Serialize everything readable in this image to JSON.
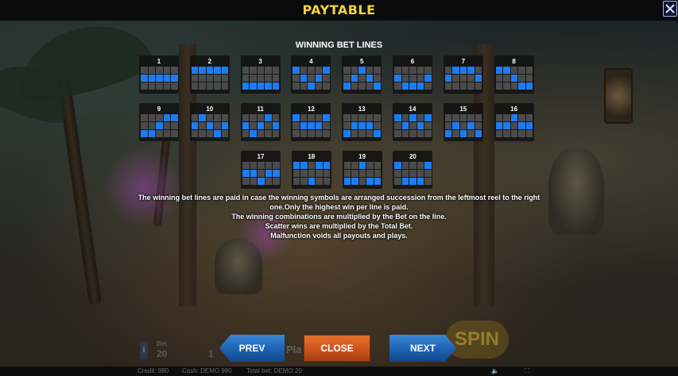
{
  "header": {
    "title": "PAYTABLE",
    "close_icon": "close-x-icon",
    "accent_color": "#f6d23a"
  },
  "section_title": "WINNING BET LINES",
  "colors": {
    "line_cell": "#1e7cf2",
    "empty_cell": "#4b4b4b",
    "card_bg": "#121212"
  },
  "bet_lines": [
    {
      "number": "1",
      "pattern": [
        1,
        1,
        1,
        1,
        1
      ]
    },
    {
      "number": "2",
      "pattern": [
        0,
        0,
        0,
        0,
        0
      ]
    },
    {
      "number": "3",
      "pattern": [
        2,
        2,
        2,
        2,
        2
      ]
    },
    {
      "number": "4",
      "pattern": [
        0,
        1,
        2,
        1,
        0
      ]
    },
    {
      "number": "5",
      "pattern": [
        2,
        1,
        0,
        1,
        2
      ]
    },
    {
      "number": "6",
      "pattern": [
        1,
        2,
        2,
        2,
        1
      ]
    },
    {
      "number": "7",
      "pattern": [
        1,
        0,
        0,
        0,
        1
      ]
    },
    {
      "number": "8",
      "pattern": [
        0,
        0,
        1,
        2,
        2
      ]
    },
    {
      "number": "9",
      "pattern": [
        2,
        2,
        1,
        0,
        0
      ]
    },
    {
      "number": "10",
      "pattern": [
        1,
        0,
        1,
        2,
        1
      ]
    },
    {
      "number": "11",
      "pattern": [
        1,
        2,
        1,
        0,
        1
      ]
    },
    {
      "number": "12",
      "pattern": [
        0,
        1,
        1,
        1,
        0
      ]
    },
    {
      "number": "13",
      "pattern": [
        2,
        1,
        1,
        1,
        2
      ]
    },
    {
      "number": "14",
      "pattern": [
        0,
        1,
        0,
        1,
        0
      ]
    },
    {
      "number": "15",
      "pattern": [
        2,
        1,
        2,
        1,
        2
      ]
    },
    {
      "number": "16",
      "pattern": [
        1,
        1,
        0,
        1,
        1
      ]
    },
    {
      "number": "17",
      "pattern": [
        1,
        1,
        2,
        1,
        1
      ]
    },
    {
      "number": "18",
      "pattern": [
        0,
        0,
        2,
        0,
        0
      ]
    },
    {
      "number": "19",
      "pattern": [
        2,
        2,
        0,
        2,
        2
      ]
    },
    {
      "number": "20",
      "pattern": [
        0,
        2,
        2,
        2,
        0
      ]
    }
  ],
  "rules": [
    "The winning bet lines are paid in case the winning symbols are arranged succession from the leftmost reel to the right",
    "one.Only the highest win per line is paid.",
    "The winning combinations are multiplied by the Bet on the line.",
    "Scatter wins are multiplied by the Total Bet.",
    "Malfunction voids all payouts and plays."
  ],
  "buttons": {
    "prev": "PREV",
    "close": "CLOSE",
    "next": "NEXT"
  },
  "hud": {
    "bet_label": "Bet",
    "bet_value": "20",
    "lines_value": "1",
    "play_label": "Pla",
    "spin_label": "SPIN"
  },
  "status": {
    "credit": "Credit:  980",
    "cash": "Cash:  DEMO 980",
    "total_bet": "Total bet:  DEMO 20"
  }
}
